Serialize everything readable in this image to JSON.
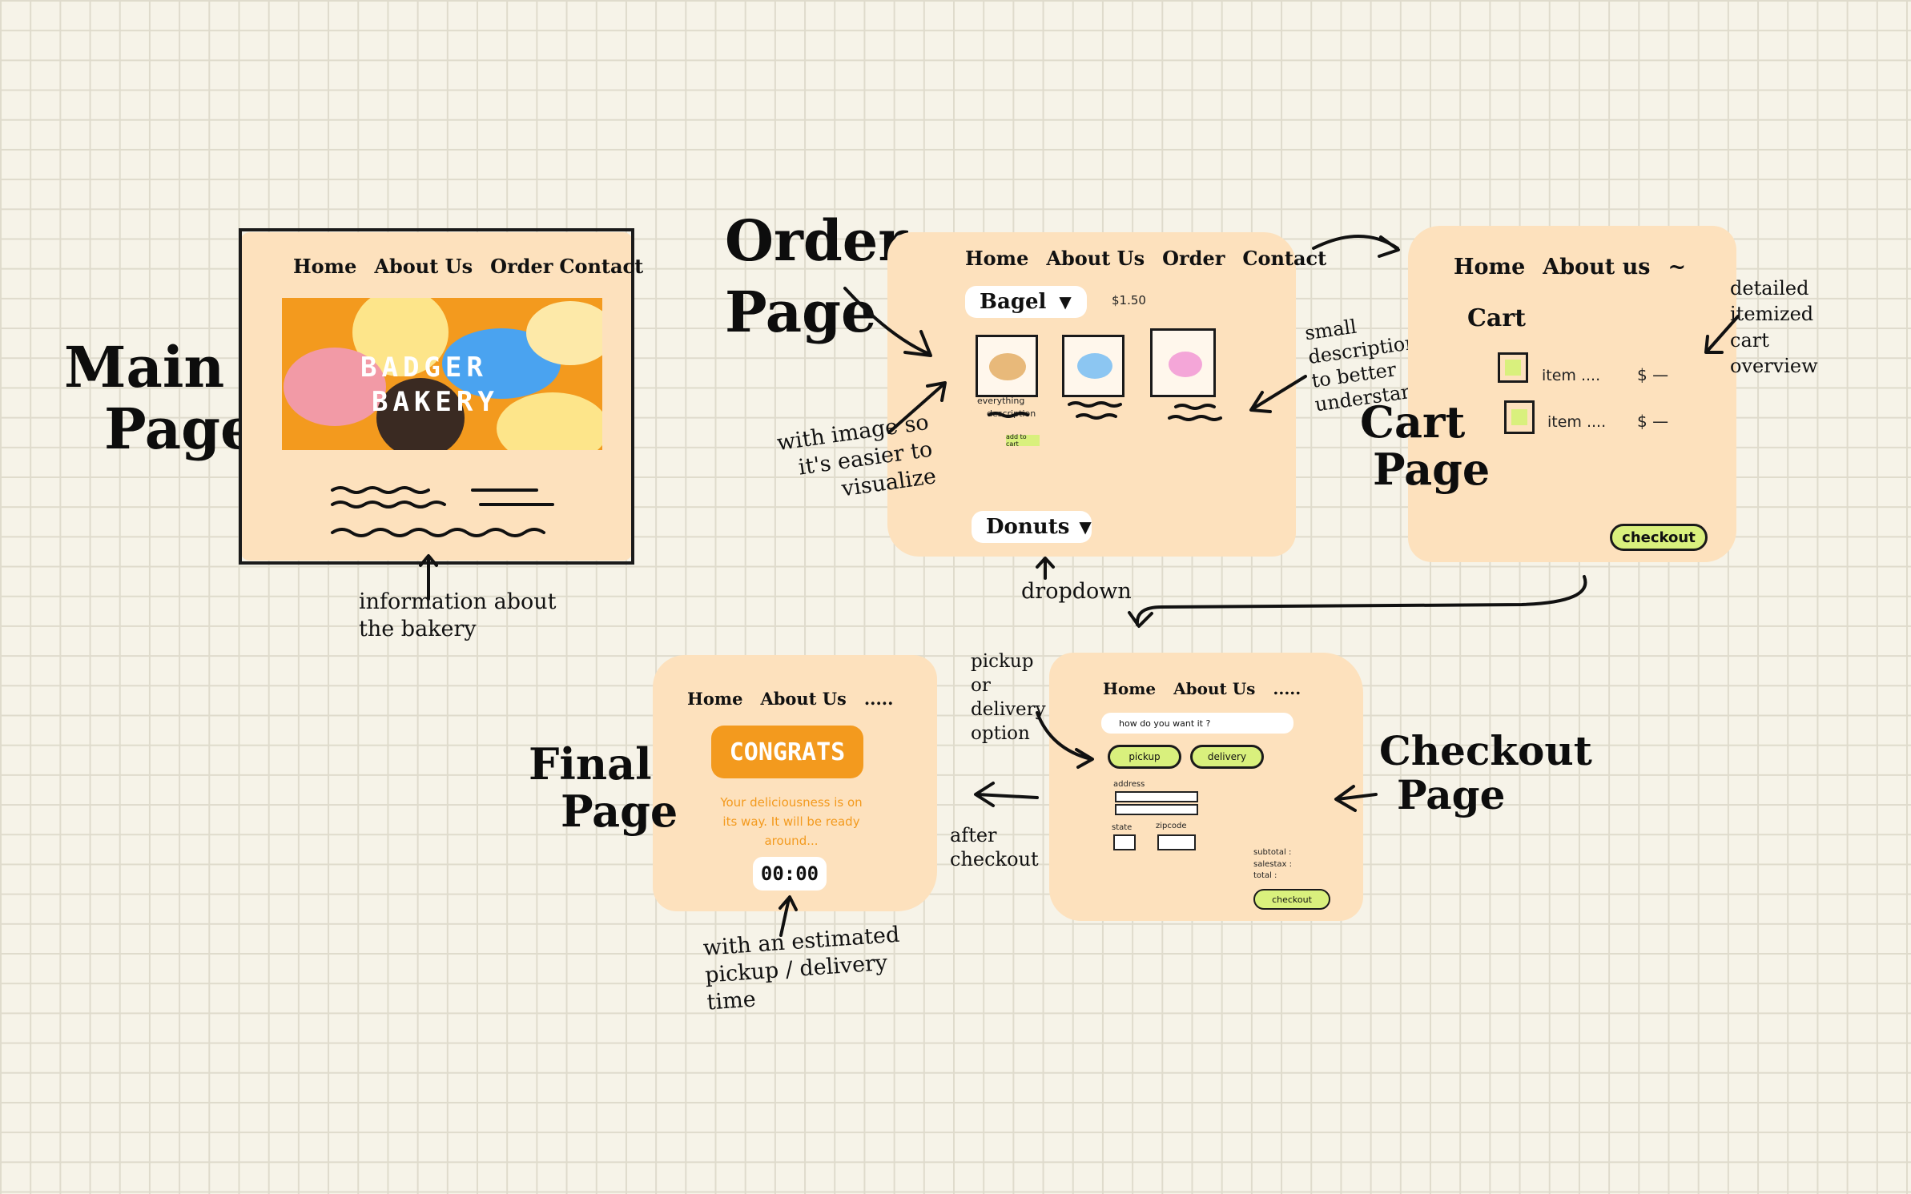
{
  "labels": {
    "main_page": [
      "Main",
      "Page"
    ],
    "order_page": [
      "Order",
      "Page"
    ],
    "cart_page": [
      "Cart",
      "Page"
    ],
    "checkout_page": [
      "Checkout",
      "Page"
    ],
    "final_page": [
      "Final",
      "Page"
    ]
  },
  "main_page": {
    "nav": [
      "Home",
      "About Us",
      "Order",
      "Contact"
    ],
    "hero_line1": "BADGER",
    "hero_line2": "BAKERY",
    "annotation": "information about the bakery"
  },
  "order_page": {
    "nav": [
      "Home",
      "About Us",
      "Order",
      "Contact"
    ],
    "bagel_dropdown": "Bagel",
    "price": "$1.50",
    "item_name": "everything",
    "item_desc": "description",
    "add_to_cart": "add to cart",
    "donuts_dropdown": "Donuts",
    "note_image": "with image so it's easier to visualize",
    "note_desc": "small description to better understand",
    "note_dropdown": "dropdown"
  },
  "cart_page": {
    "nav": [
      "Home",
      "About us"
    ],
    "title": "Cart",
    "items": [
      {
        "name": "item ....",
        "price": "$ —"
      },
      {
        "name": "item ....",
        "price": "$ —"
      }
    ],
    "checkout_button": "checkout",
    "note": "detailed itemized cart overview"
  },
  "checkout_page": {
    "nav": [
      "Home",
      "About Us",
      "....."
    ],
    "question": "how do you want it ?",
    "pickup_button": "pickup",
    "delivery_button": "delivery",
    "address_label": "address",
    "state_label": "state",
    "zipcode_label": "zipcode",
    "subtotal": "subtotal :",
    "salestax": "salestax :",
    "total": "total :",
    "checkout_button": "checkout",
    "note_option": "pickup or delivery option",
    "note_after": "after checkout"
  },
  "final_page": {
    "nav": [
      "Home",
      "About Us",
      "....."
    ],
    "congrats": "CONGRATS",
    "message": "Your deliciousness is on its way. It will be ready around...",
    "timer": "00:00",
    "note": "with an estimated pickup / delivery time"
  },
  "colors": {
    "blob": "#fde1bd",
    "orange": "#f39a1e",
    "green": "#d9f07d",
    "blue": "#4aa3f0",
    "pink": "#f29aa6",
    "yellow": "#fde58a"
  }
}
